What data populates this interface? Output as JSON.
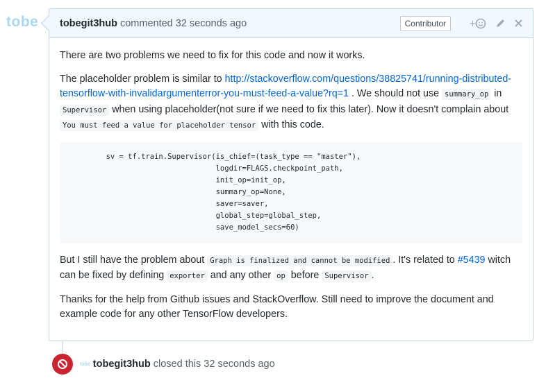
{
  "avatar": {
    "label": "tobe"
  },
  "comment": {
    "author": "tobegit3hub",
    "meta": "commented 32 seconds ago",
    "badge": "Contributor",
    "add_reaction_icon": "smiley-plus-icon",
    "edit_icon": "pencil-icon",
    "delete_icon": "close-icon",
    "p1": "There are two problems we need to fix for this code and now it works.",
    "p2_pre": "The placeholder problem is similar to ",
    "p2_link": "http://stackoverflow.com/questions/38825741/running-distributed-tensorflow-with-invalidargumenterror-you-must-feed-a-value?rq=1",
    "p2_mid1": " . We should not use ",
    "p2_code1": "summary_op",
    "p2_mid2": " in ",
    "p2_code2": "Supervisor",
    "p2_mid3": " when using placeholder(not sure if we need to fix this later). Now it doesn't complain about ",
    "p2_code3": "You must feed a value for placeholder tensor",
    "p2_end": " with this code.",
    "code_block": "        sv = tf.train.Supervisor(is_chief=(task_type == \"master\"),\n                                 logdir=FLAGS.checkpoint_path,\n                                 init_op=init_op,\n                                 summary_op=None,\n                                 saver=saver,\n                                 global_step=global_step,\n                                 save_model_secs=60)",
    "p3_pre": "But I still have the problem about ",
    "p3_code1": "Graph is finalized and cannot be modified",
    "p3_mid1": ". It's related to ",
    "p3_link": "#5439",
    "p3_mid2": " witch can be fixed by defining ",
    "p3_code2": "exporter",
    "p3_mid3": " and any other ",
    "p3_code3": "op",
    "p3_mid4": " before ",
    "p3_code4": "Supervisor",
    "p3_end": ".",
    "p4": "Thanks for the help from Github issues and StackOverflow. Still need to improve the document and example code for any other TensorFlow developers."
  },
  "event": {
    "icon": "circle-slash-icon",
    "mini_avatar": "tobe",
    "author": "tobegit3hub",
    "text": "closed this 32 seconds ago",
    "badge_color": "#cb2431"
  }
}
